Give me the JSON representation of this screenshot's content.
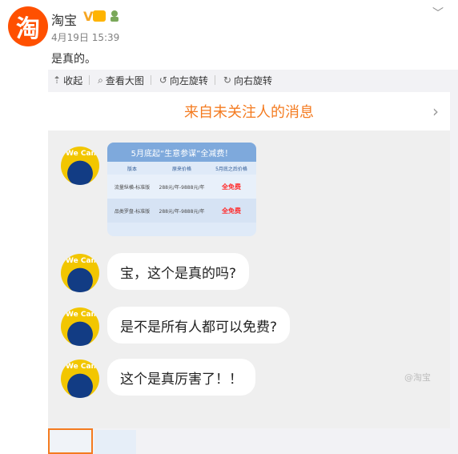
{
  "post": {
    "author": "淘宝",
    "verified_mark": "V",
    "time": "4月19日 15:39",
    "text": "是真的。",
    "logo_glyph": "淘"
  },
  "toolbar": {
    "collapse": "收起",
    "view_large": "查看大图",
    "rotate_left": "向左旋转",
    "rotate_right": "向右旋转"
  },
  "screenshot": {
    "header_title": "来自未关注人的消息",
    "avatar_label": "We Can",
    "card": {
      "title": "5月底起“生意参谋”全减费！",
      "columns": [
        "版本",
        "原来价格",
        "5月底之后价格"
      ],
      "rows": [
        {
          "name": "流量纵横-标准版",
          "price": "288元/年-9888元/年",
          "after": "全免费"
        },
        {
          "name": "品类罗盘-标准版",
          "price": "288元/年-9888元/年",
          "after": "全免费"
        }
      ]
    },
    "messages": [
      "宝，这个是真的吗?",
      "是不是所有人都可以免费?",
      "这个是真厉害了！！"
    ],
    "watermark": "@淘宝"
  }
}
